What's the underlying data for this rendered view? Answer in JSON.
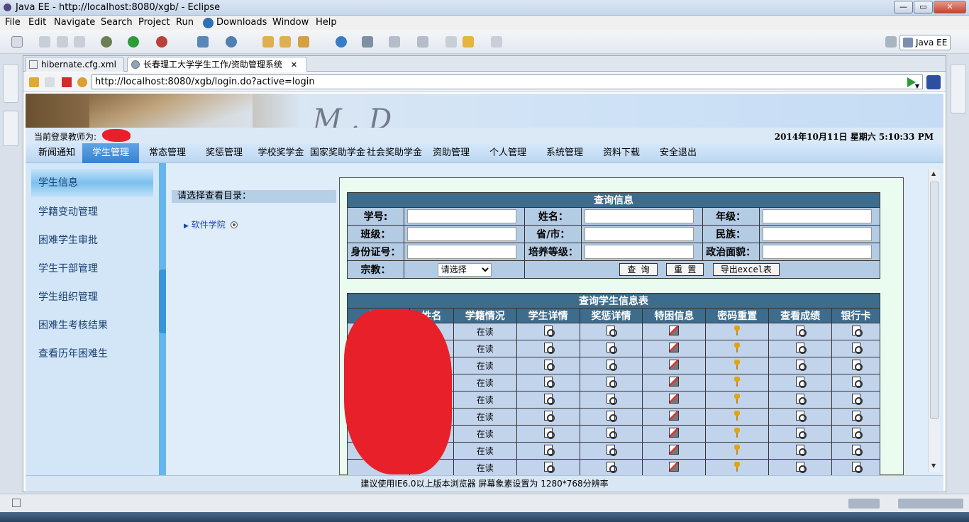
{
  "window": {
    "title": "Java EE - http://localhost:8080/xgb/ - Eclipse",
    "minimize": "—",
    "maximize": "▭",
    "close": "✕"
  },
  "menubar": [
    "File",
    "Edit",
    "Navigate",
    "Search",
    "Project",
    "Run",
    "Downloads",
    "Window",
    "Help"
  ],
  "toolbar": {
    "perspective": "Java EE"
  },
  "tabs": [
    {
      "label": "hibernate.cfg.xml"
    },
    {
      "label": "长春理工大学学生工作/资助管理系统",
      "close": "✕"
    }
  ],
  "address": {
    "url": "http://localhost:8080/xgb/login.do?active=login"
  },
  "page": {
    "teacher_label": "当前登录教师为:",
    "datetime": "2014年10月11日  星期六  5:10:33 PM",
    "nav": [
      "新闻通知",
      "学生管理",
      "常态管理",
      "奖惩管理",
      "学校奖学金",
      "国家奖助学金",
      "社会奖助学金",
      "资助管理",
      "个人管理",
      "系统管理",
      "资料下载",
      "安全退出"
    ],
    "left_menu": [
      "学生信息",
      "学籍变动管理",
      "困难学生审批",
      "学生干部管理",
      "学生组织管理",
      "困难生考核结果",
      "查看历年困难生"
    ],
    "mid_title": "请选择查看目录：",
    "tree_item": "软件学院",
    "query": {
      "title": "查询信息",
      "labels": [
        "学号:",
        "姓名：",
        "年级：",
        "班级：",
        "省/市：",
        "民族：",
        "身份证号：",
        "培养等级：",
        "政治面貌：",
        "宗教："
      ],
      "religion_select": "请选择",
      "btn_query": "查  询",
      "btn_reset": "重  置",
      "btn_export": "导出excel表"
    },
    "results": {
      "title": "查询学生信息表",
      "columns": [
        "学号",
        "姓名",
        "学籍情况",
        "学生详情",
        "奖惩详情",
        "特困信息",
        "密码重置",
        "查看成绩",
        "银行卡"
      ],
      "rows": [
        {
          "status": "在读"
        },
        {
          "status": "在读"
        },
        {
          "status": "在读"
        },
        {
          "status": "在读"
        },
        {
          "status": "在读"
        },
        {
          "status": "在读"
        },
        {
          "status": "在读"
        },
        {
          "status": "在读"
        },
        {
          "status": "在读"
        }
      ]
    },
    "footer": "建议使用IE6.0以上版本浏览器  屏幕象素设置为  1280*768分辨率"
  },
  "colors": {
    "nav_active": "#3a82d0",
    "table_header": "#3d6c8c",
    "redaction": "#e8202a"
  }
}
